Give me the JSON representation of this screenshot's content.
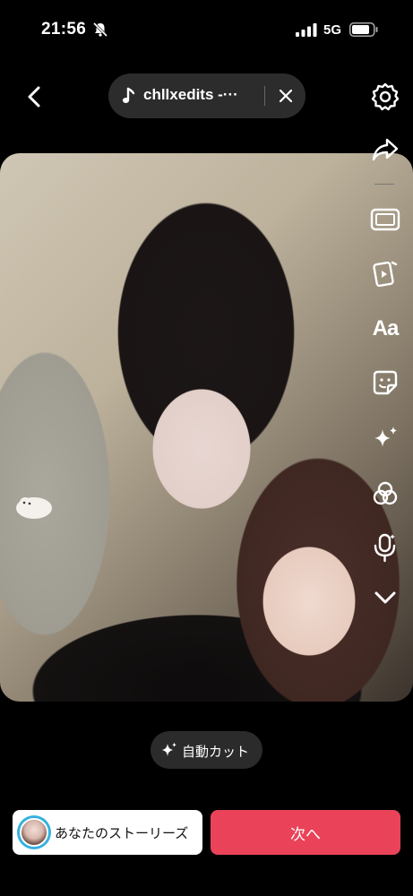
{
  "status_bar": {
    "time": "21:56",
    "network": "5G",
    "icons": [
      "bell-slash-icon",
      "signal-icon",
      "battery-icon"
    ]
  },
  "header": {
    "back_icon": "chevron-left-icon",
    "music": {
      "icon": "music-note-icon",
      "title": "chllxedits -···",
      "close_icon": "close-icon"
    }
  },
  "toolbar": {
    "items": [
      {
        "name": "settings",
        "icon": "gear-icon"
      },
      {
        "name": "share",
        "icon": "share-arrow-icon"
      },
      {
        "name": "frame",
        "icon": "frame-icon"
      },
      {
        "name": "clips",
        "icon": "clips-icon"
      },
      {
        "name": "text",
        "icon": "text-icon",
        "label": "Aa"
      },
      {
        "name": "sticker",
        "icon": "sticker-icon"
      },
      {
        "name": "effects",
        "icon": "sparkle-icon"
      },
      {
        "name": "filters",
        "icon": "filters-icon"
      },
      {
        "name": "voice",
        "icon": "mic-icon"
      },
      {
        "name": "more",
        "icon": "chevron-down-icon"
      }
    ]
  },
  "autocut": {
    "label": "自動カット",
    "icon": "sparkle-icon"
  },
  "footer": {
    "story_label": "あなたのストーリーズ",
    "next_label": "次へ"
  },
  "colors": {
    "background": "#000000",
    "accent": "#ea4359",
    "pill": "#2c2c2c"
  }
}
